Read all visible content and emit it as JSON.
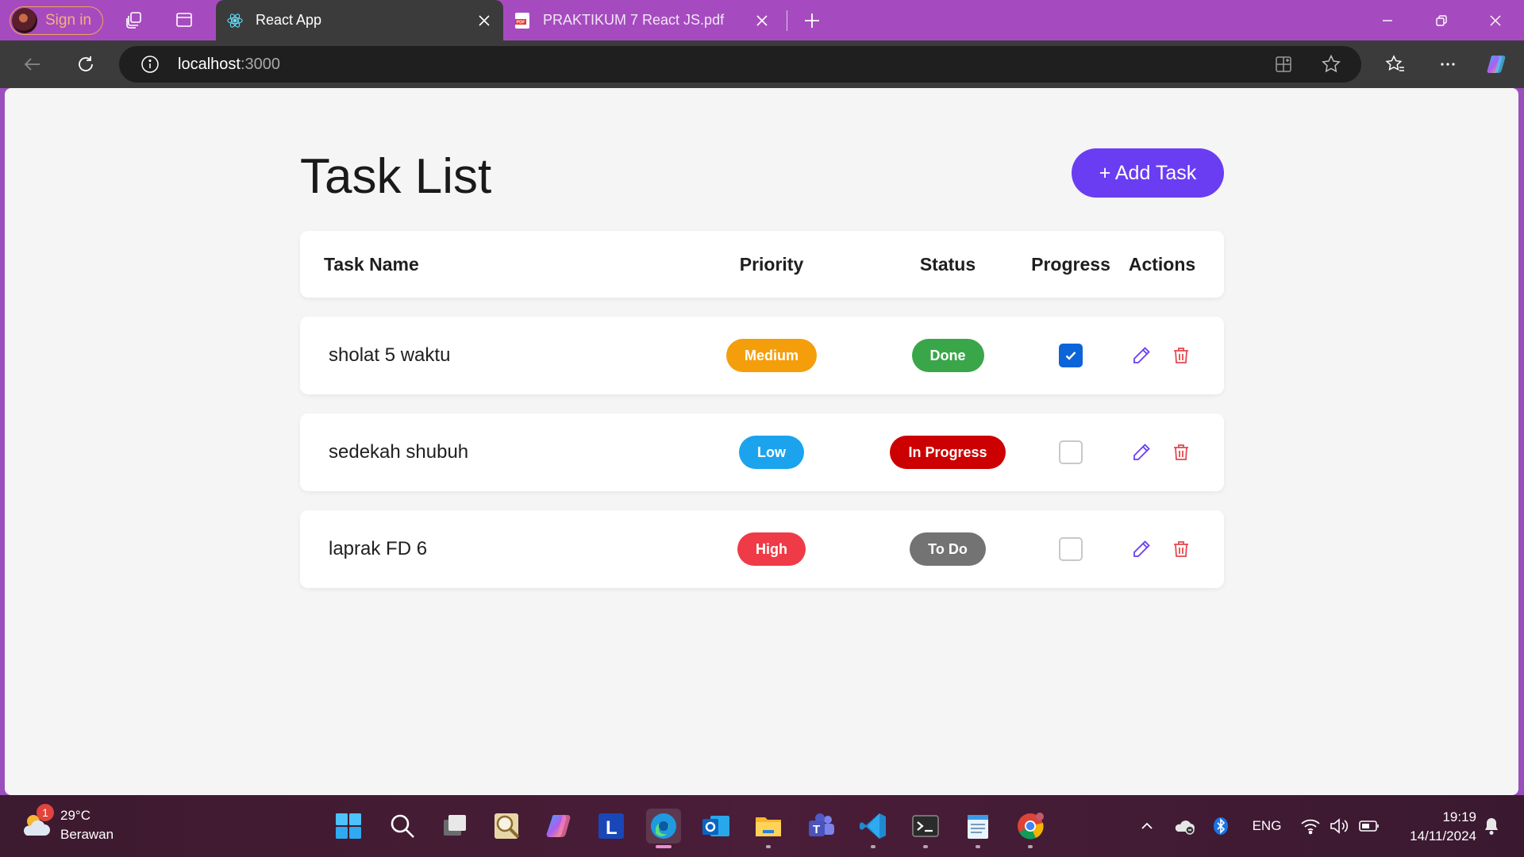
{
  "browser": {
    "profile_label": "Sign in",
    "tabs": [
      {
        "title": "React App",
        "favicon": "react-icon",
        "active": true
      },
      {
        "title": "PRAKTIKUM 7 React JS.pdf",
        "favicon": "pdf-icon",
        "active": false
      }
    ],
    "url_host": "localhost",
    "url_port": ":3000"
  },
  "page": {
    "title": "Task List",
    "add_button_label": "+ Add Task",
    "columns": {
      "task_name": "Task Name",
      "priority": "Priority",
      "status": "Status",
      "progress": "Progress",
      "actions": "Actions"
    },
    "tasks": [
      {
        "name": "sholat 5 waktu",
        "priority": "Medium",
        "status": "Done",
        "done": true
      },
      {
        "name": "sedekah shubuh",
        "priority": "Low",
        "status": "In Progress",
        "done": false
      },
      {
        "name": "laprak FD 6",
        "priority": "High",
        "status": "To Do",
        "done": false
      }
    ]
  },
  "colors": {
    "accent": "#6a3df2",
    "priority_medium": "#f59e0b",
    "priority_low": "#1ba3ee",
    "priority_high": "#ef3b47",
    "status_done": "#3aa64a",
    "status_in_progress": "#cc0000",
    "status_todo": "#737373",
    "edit_icon": "#6a3df2",
    "delete_icon": "#e5484d",
    "checkbox_checked": "#0b64d8"
  },
  "taskbar": {
    "weather_temp": "29°C",
    "weather_desc": "Berawan",
    "weather_badge": "1",
    "apps": [
      "start-icon",
      "search-icon",
      "task-view-icon",
      "file-search-icon",
      "copilot-icon",
      "l-app-icon",
      "edge-icon",
      "outlook-icon",
      "file-explorer-icon",
      "teams-icon",
      "vscode-icon",
      "terminal-icon",
      "notepad-icon",
      "chrome-icon"
    ],
    "language": "ENG",
    "time": "19:19",
    "date": "14/11/2024"
  }
}
